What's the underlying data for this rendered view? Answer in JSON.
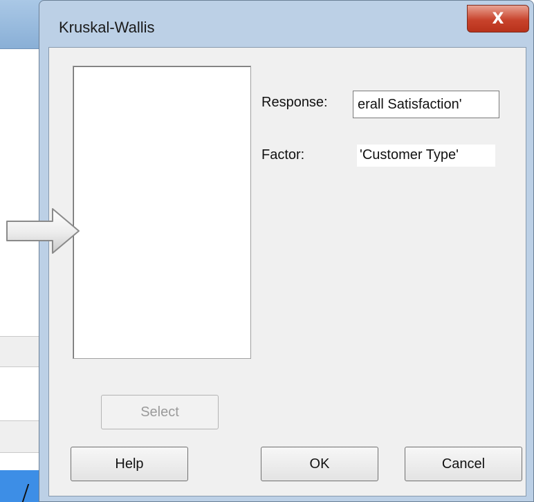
{
  "dialog": {
    "title": "Kruskal-Wallis",
    "close_label": "X"
  },
  "form": {
    "response_label": "Response:",
    "response_value": "erall Satisfaction'",
    "factor_label": "Factor:",
    "factor_value": "'Customer Type'"
  },
  "buttons": {
    "select": "Select",
    "help": "Help",
    "ok": "OK",
    "cancel": "Cancel"
  },
  "colors": {
    "dialog_frame": "#bcd0e6",
    "client_bg": "#f0f0f0",
    "close_button": "#c8432c",
    "selected_row": "#3d8ee6"
  },
  "icons": {
    "close": "close-icon",
    "pointer_arrow": "right-arrow-icon",
    "cursor": "mouse-cursor-icon"
  }
}
